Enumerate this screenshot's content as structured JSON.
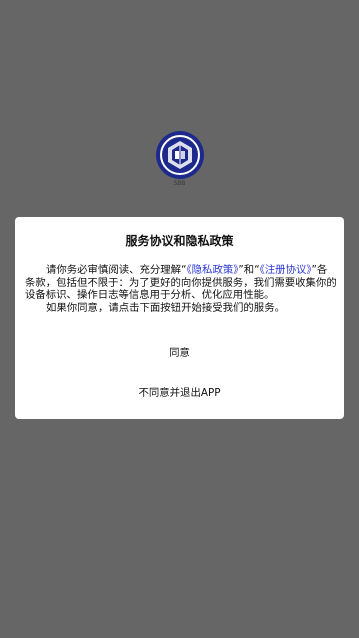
{
  "splash": {
    "logo_icon": "app-logo-icon",
    "caption": "SBB"
  },
  "dialog": {
    "title": "服务协议和隐私政策",
    "intro_1": "请你务必审慎阅读、充分理解“",
    "privacy_link": "《隐私政策》",
    "intro_2": "”和“",
    "register_link": "《注册协议》",
    "intro_3": "”各条款，包括但不限于：为了更好的向你提供服务，我们需要收集你的设备标识、操作日志等信息用于分析、优化应用性能。",
    "paragraph_2": "如果你同意，请点击下面按钮开始接受我们的服务。",
    "agree_label": "同意",
    "disagree_label": "不同意并退出APP"
  },
  "colors": {
    "overlay": "#666666",
    "dialog_bg": "#ffffff",
    "link": "#2a36d8",
    "logo_blue": "#1d2a8c"
  }
}
